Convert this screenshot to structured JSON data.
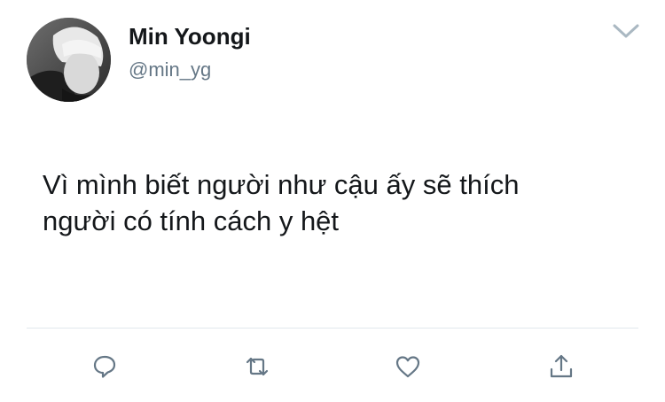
{
  "user": {
    "display_name": "Min Yoongi",
    "handle": "@min_yg"
  },
  "tweet": {
    "text": "Vì mình biết người như cậu ấy sẽ thích\nngười có tính cách y hệt"
  },
  "icons": {
    "menu": "chevron-down-icon",
    "reply": "reply-icon",
    "retweet": "retweet-icon",
    "like": "heart-icon",
    "share": "share-icon"
  },
  "colors": {
    "text": "#14171a",
    "secondary": "#657786",
    "icon": "#657786",
    "divider": "#e1e8ed"
  }
}
